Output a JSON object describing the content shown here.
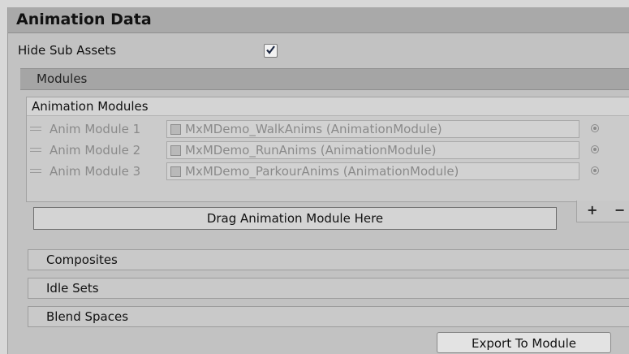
{
  "header": {
    "title": "Animation Data"
  },
  "hide_sub_assets": {
    "label": "Hide Sub Assets",
    "checked": true
  },
  "modules_section": {
    "label": "Modules"
  },
  "animation_modules": {
    "header": "Animation Modules",
    "items": [
      {
        "label": "Anim Module 1",
        "value": "MxMDemo_WalkAnims (AnimationModule)"
      },
      {
        "label": "Anim Module 2",
        "value": "MxMDemo_RunAnims (AnimationModule)"
      },
      {
        "label": "Anim Module 3",
        "value": "MxMDemo_ParkourAnims (AnimationModule)"
      }
    ],
    "drop_label": "Drag Animation Module Here",
    "add_label": "+",
    "remove_label": "−"
  },
  "sections": [
    {
      "label": "Composites"
    },
    {
      "label": "Idle Sets"
    },
    {
      "label": "Blend Spaces"
    }
  ],
  "export_button": {
    "label": "Export To Module"
  }
}
